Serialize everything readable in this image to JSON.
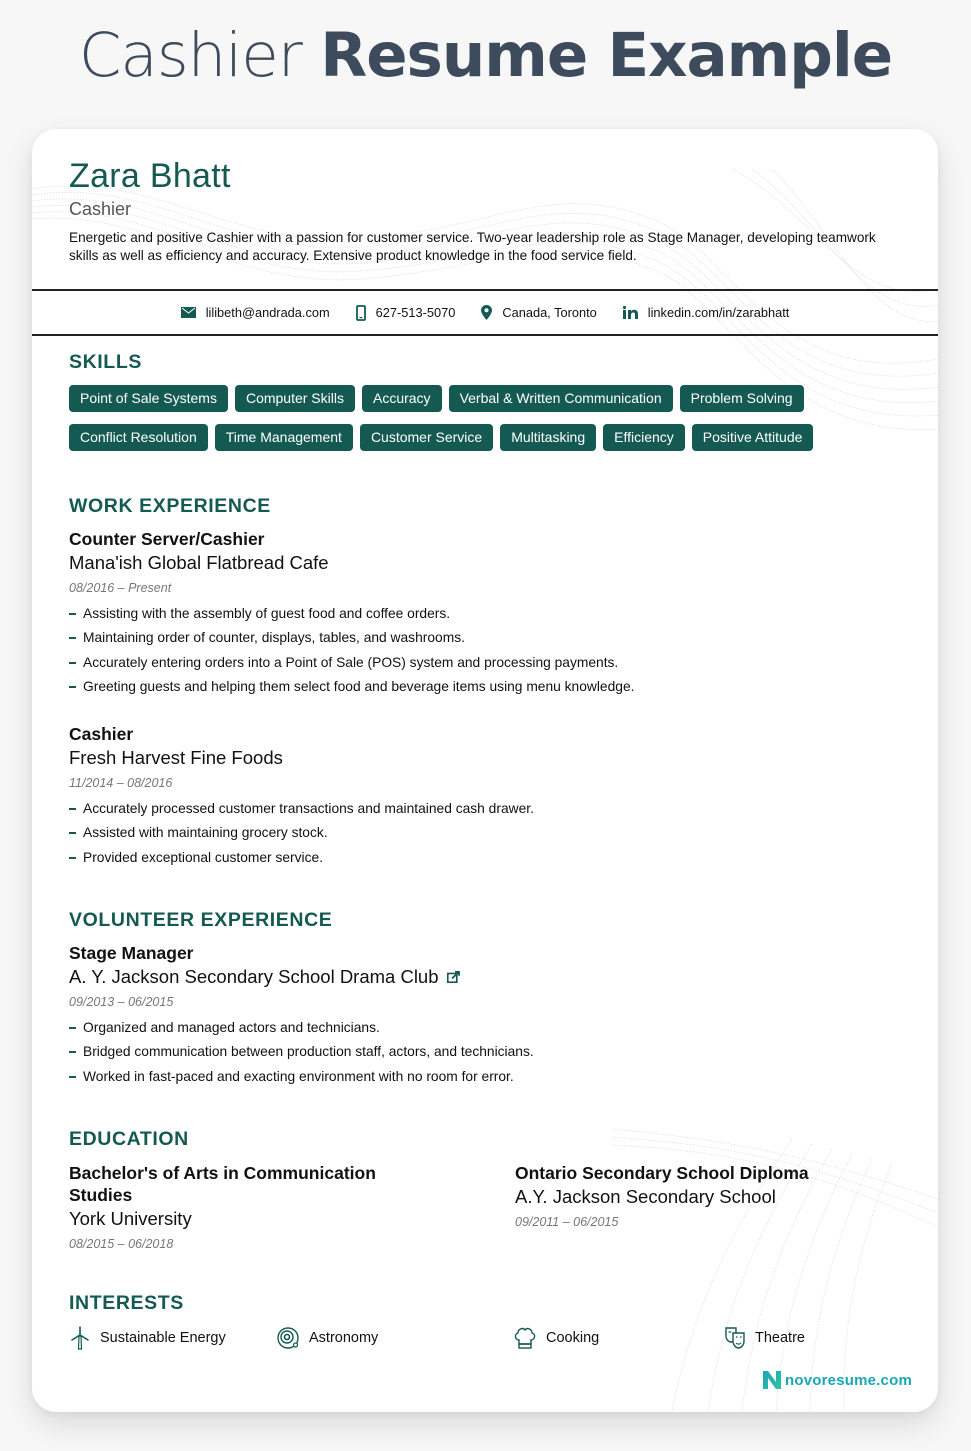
{
  "page": {
    "title_light": "Cashier",
    "title_bold": "Resume Example"
  },
  "header": {
    "name": "Zara Bhatt",
    "role": "Cashier",
    "summary": "Energetic and positive Cashier with a passion for customer service. Two-year leadership role as Stage Manager, developing teamwork skills as well as efficiency and accuracy. Extensive product knowledge in the food service field."
  },
  "contact": {
    "email": "lilibeth@andrada.com",
    "phone": "627-513-5070",
    "location": "Canada, Toronto",
    "linkedin": "linkedin.com/in/zarabhatt",
    "icons": [
      "envelope-icon",
      "phone-icon",
      "map-pin-icon",
      "linkedin-icon"
    ]
  },
  "colors": {
    "accent": "#155a52",
    "title": "#3d4b5c",
    "date": "#777777",
    "brand": "#1ba7b4"
  },
  "skills": {
    "heading": "SKILLS",
    "row1": [
      "Point of Sale Systems",
      "Computer Skills",
      "Accuracy",
      "Verbal & Written Communication",
      "Problem Solving"
    ],
    "row2": [
      "Conflict Resolution",
      "Time Management",
      "Customer Service",
      "Multitasking",
      "Efficiency",
      "Positive Attitude"
    ]
  },
  "work": {
    "heading": "WORK EXPERIENCE",
    "jobs": [
      {
        "title": "Counter Server/Cashier",
        "org": "Mana'ish Global Flatbread Cafe",
        "date": "08/2016 – Present",
        "bullets": [
          "Assisting with the assembly of guest food and coffee orders.",
          "Maintaining order of counter, displays, tables, and washrooms.",
          "Accurately entering orders into a Point of Sale (POS) system and processing payments.",
          "Greeting guests and helping them select food and beverage items using menu knowledge."
        ]
      },
      {
        "title": "Cashier",
        "org": "Fresh Harvest Fine Foods",
        "date": "11/2014 – 08/2016",
        "bullets": [
          "Accurately processed customer transactions and maintained cash drawer.",
          "Assisted with maintaining grocery stock.",
          "Provided exceptional customer service."
        ]
      }
    ]
  },
  "volunteer": {
    "heading": "VOLUNTEER EXPERIENCE",
    "jobs": [
      {
        "title": "Stage Manager",
        "org": "A. Y. Jackson Secondary School Drama Club",
        "link_icon": "external-link-icon",
        "date": "09/2013 – 06/2015",
        "bullets": [
          "Organized and managed actors and technicians.",
          "Bridged communication between production staff, actors, and technicians.",
          "Worked in fast-paced and exacting environment with no room for error."
        ]
      }
    ]
  },
  "education": {
    "heading": "EDUCATION",
    "items": [
      {
        "title": "Bachelor's of Arts in Communication Studies",
        "org": "York University",
        "date": "08/2015 – 06/2018"
      },
      {
        "title": "Ontario Secondary School Diploma",
        "org": "A.Y. Jackson Secondary School",
        "date": "09/2011 – 06/2015"
      }
    ]
  },
  "interests": {
    "heading": "INTERESTS",
    "items": [
      {
        "label": "Sustainable Energy",
        "icon": "wind-turbine-icon"
      },
      {
        "label": "Astronomy",
        "icon": "planet-icon"
      },
      {
        "label": "Cooking",
        "icon": "chef-hat-icon"
      },
      {
        "label": "Theatre",
        "icon": "theatre-masks-icon"
      }
    ]
  },
  "brand": {
    "name": "novoresume.com"
  }
}
